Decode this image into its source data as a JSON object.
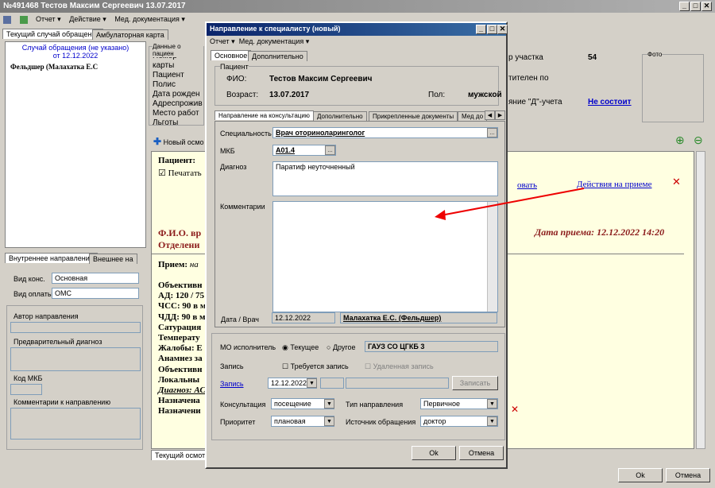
{
  "window": {
    "title": "№491468 Тестов Максим Сергеевич 13.07.2017",
    "controls": [
      "_",
      "□",
      "✕"
    ]
  },
  "menu": {
    "report": "Отчет ▾",
    "action": "Действие ▾",
    "med_docs": "Мед. документация ▾"
  },
  "tabs": {
    "current": "Текущий случай обращения",
    "ambulatory": "Амбулаторная карта"
  },
  "tree": {
    "case": "Случай обращения (не указано)",
    "case_date": "от 12.12.2022",
    "doctor": "Фельдшер (Малахатка Е.С"
  },
  "patient_data": {
    "legend": "Данные о пациен",
    "labels": [
      "Номер карты",
      "Пациент",
      "Полис",
      "Дата рожден",
      "Адреспрожив",
      "Место работ",
      "Льготы"
    ]
  },
  "right_info": {
    "uchastok_label": "р участка",
    "uchastok_value": "54",
    "prikreplen": "тителен по",
    "d_label": "яние \"Д\"-учета",
    "d_value": "Не состоит",
    "photo": "Фото"
  },
  "new_exam": "Новый осмо",
  "protocol": {
    "patient": "Пациент: ",
    "print": "Печатать",
    "fio": "Ф.И.О. вр",
    "dept": "Отделени",
    "priem": "Прием:",
    "priem_val": " на ",
    "date": "Дата приема: 12.12.2022 14:20",
    "lines": [
      "Объективн",
      "АД: 120 / 75",
      "ЧСС: 90 в м",
      "ЧДД: 90 в м",
      "Сатурация",
      "Температу",
      "Жалобы: Е",
      "Анамнез за",
      "Объективн",
      "Локальны",
      "Диагноз: АС",
      "Назначена",
      "Назначени"
    ],
    "edit_link": "овать",
    "actions_link": "Действия на приеме",
    "bottom_tab": "Текущий осмотр"
  },
  "lower_left": {
    "tab1": "Внутреннее направление",
    "tab2": "Внешнее на",
    "vid_kons_label": "Вид конс.",
    "vid_kons": "Основная",
    "vid_opl_label": "Вид оплаты",
    "vid_opl": "ОМС",
    "author": "Автор направления",
    "prelim": "Предварительный диагноз",
    "mkb": "Код МКБ",
    "comments": "Комментарии к направлению"
  },
  "main_buttons": {
    "ok": "Ok",
    "cancel": "Отмена"
  },
  "dialog": {
    "title": "Направление к специалисту (новый)",
    "menu_report": "Отчет ▾",
    "menu_med": "Мед. документация ▾",
    "tab_main": "Основное",
    "tab_extra": "Дополнительно",
    "patient_legend": "Пациент",
    "fio_label": "ФИО:",
    "fio": "Тестов Максим Сергеевич",
    "age_label": "Возраст:",
    "age": "13.07.2017",
    "sex_label": "Пол:",
    "sex": "мужской",
    "subtabs": [
      "Направление на консультацию",
      "Дополнительно",
      "Прикрепленные документы",
      "Мед до"
    ],
    "spec_label": "Специальность",
    "spec": "Врач оториноларинголог",
    "mkb_label": "МКБ",
    "mkb": "А01.4",
    "diag_label": "Диагноз",
    "diag": "Паратиф неуточненный",
    "comment_label": "Комментарии",
    "comment": "",
    "date_label": "Дата / Врач",
    "date": "12.12.2022",
    "doctor": "Малахатка Е.С. (Фельдшер)",
    "mo_label": "МО исполнитель",
    "mo_current": "Текущее",
    "mo_other": "Другое",
    "mo_value": "ГАУЗ СО ЦГКБ 3",
    "zapis_label": "Запись",
    "zapis_req": "Требуется запись",
    "zapis_remote": "Удаленная запись",
    "zapis_link": "Запись",
    "zapis_date": "12.12.2022",
    "zapis_btn": "Записать",
    "kons_label": "Консультация",
    "kons": "посещение",
    "tip_label": "Тип направления",
    "tip": "Первичное",
    "prior_label": "Приоритет",
    "prior": "плановая",
    "src_label": "Источник обращения",
    "src": "доктор",
    "ok": "Ok",
    "cancel": "Отмена"
  }
}
